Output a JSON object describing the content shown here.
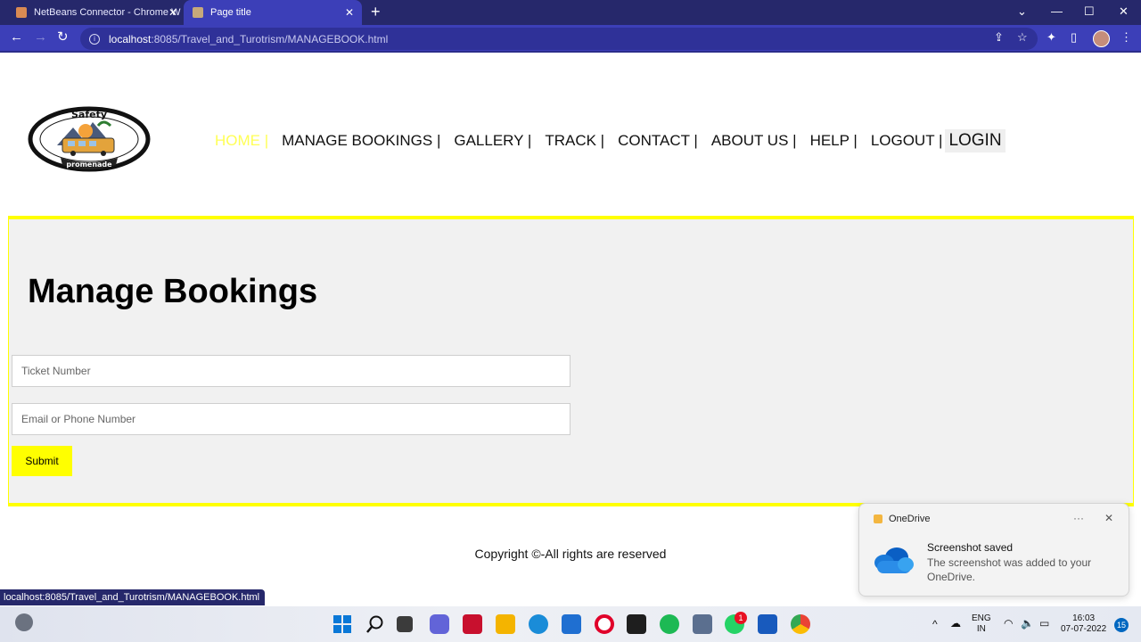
{
  "browser": {
    "tabs": [
      {
        "title": "NetBeans Connector - Chrome W"
      },
      {
        "title": "Page title"
      }
    ],
    "url_host": "localhost",
    "url_path": ":8085/Travel_and_Turotrism/MANAGEBOOK.html",
    "status_url": "localhost:8085/Travel_and_Turotrism/MANAGEBOOK.html"
  },
  "site": {
    "logo_text_top": "Safety",
    "logo_text_bottom": "promenade",
    "nav": [
      {
        "label": "HOME |",
        "active": true
      },
      {
        "label": "MANAGE BOOKINGS |"
      },
      {
        "label": "GALLERY |"
      },
      {
        "label": "TRACK |"
      },
      {
        "label": "CONTACT |"
      },
      {
        "label": "ABOUT US |"
      },
      {
        "label": "HELP |"
      },
      {
        "label": "LOGOUT |"
      }
    ],
    "login_label": "LOGIN"
  },
  "main": {
    "heading": "Manage Bookings",
    "ticket_placeholder": "Ticket Number",
    "contact_placeholder": "Email or Phone Number",
    "submit_label": "Submit",
    "accent_color": "#ffff00"
  },
  "footer": {
    "copyright": "Copyright ©-All rights are reserved"
  },
  "toast": {
    "app": "OneDrive",
    "title": "Screenshot saved",
    "message": "The screenshot was added to your OneDrive."
  },
  "taskbar": {
    "whatsapp_badge": "1",
    "lang_top": "ENG",
    "lang_bottom": "IN",
    "time": "16:03",
    "date": "07-07-2022",
    "notifications": "15"
  }
}
